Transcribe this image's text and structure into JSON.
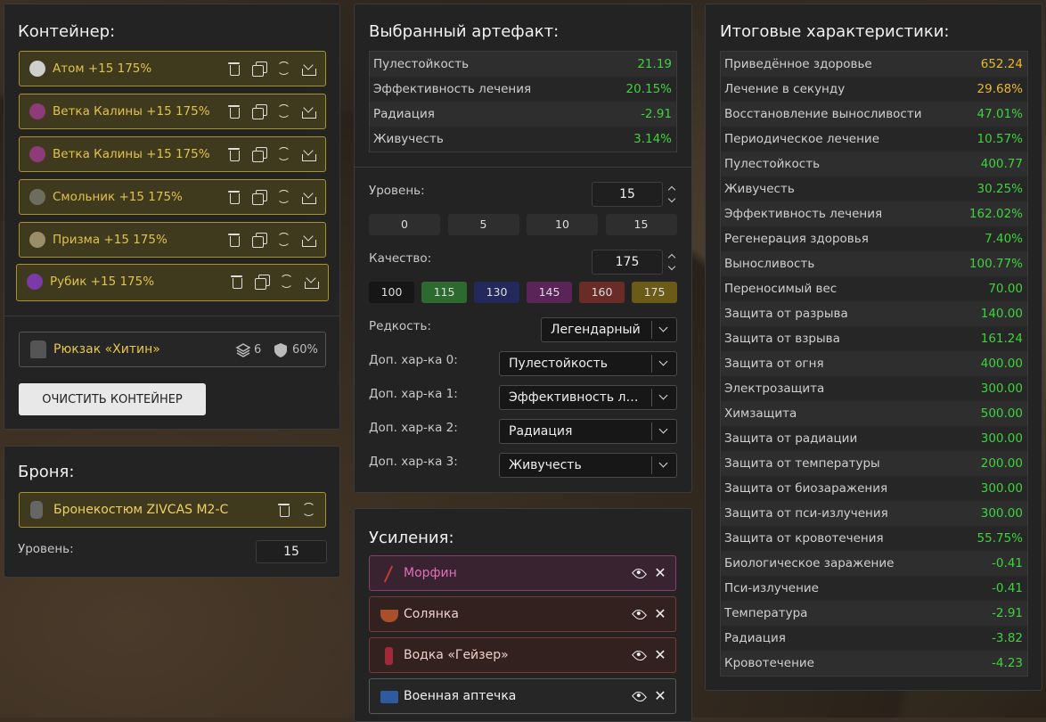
{
  "container": {
    "title": "Контейнер:",
    "artifacts": [
      {
        "name": "Атом +15 175%",
        "icon": "atom-icon",
        "color": "#cfcfcf"
      },
      {
        "name": "Ветка Калины +15 175%",
        "icon": "viburnum-icon",
        "color": "#8e3b7a"
      },
      {
        "name": "Ветка Калины +15 175%",
        "icon": "viburnum-icon",
        "color": "#8e3b7a"
      },
      {
        "name": "Смольник +15 175%",
        "icon": "resin-icon",
        "color": "#6d6d5f"
      },
      {
        "name": "Призма +15 175%",
        "icon": "prism-icon",
        "color": "#9a8e6a"
      },
      {
        "name": "Рубик +15 175%",
        "icon": "rubik-icon",
        "color": "#7a3aa8"
      }
    ],
    "backpack": {
      "name": "Рюкзак «Хитин»",
      "slots": "6",
      "protection": "60%"
    },
    "clear_button": "ОЧИСТИТЬ КОНТЕЙНЕР"
  },
  "armor": {
    "title": "Броня:",
    "name": "Бронекостюм ZIVCAS M2-C",
    "level_label": "Уровень:",
    "level": "15"
  },
  "selected": {
    "title": "Выбранный артефакт:",
    "stats": [
      {
        "name": "Пулестойкость",
        "value": "21.19"
      },
      {
        "name": "Эффективность лечения",
        "value": "20.15%"
      },
      {
        "name": "Радиация",
        "value": "-2.91"
      },
      {
        "name": "Живучесть",
        "value": "3.14%"
      }
    ],
    "level_label": "Уровень:",
    "level": "15",
    "level_presets": [
      "0",
      "5",
      "10",
      "15"
    ],
    "quality_label": "Качество:",
    "quality": "175",
    "quality_presets": [
      {
        "label": "100",
        "color": "#161616"
      },
      {
        "label": "115",
        "color": "#2d6a2f"
      },
      {
        "label": "130",
        "color": "#23295a"
      },
      {
        "label": "145",
        "color": "#5a2458"
      },
      {
        "label": "160",
        "color": "#6a2c26"
      },
      {
        "label": "175",
        "color": "#6c5b18"
      }
    ],
    "rarity_label": "Редкость:",
    "rarity": "Легендарный",
    "extras": [
      {
        "label": "Доп. хар-ка 0:",
        "value": "Пулестойкость"
      },
      {
        "label": "Доп. хар-ка 1:",
        "value": "Эффективность ле..."
      },
      {
        "label": "Доп. хар-ка 2:",
        "value": "Радиация"
      },
      {
        "label": "Доп. хар-ка 3:",
        "value": "Живучесть"
      }
    ]
  },
  "boosts": {
    "title": "Усиления:",
    "items": [
      {
        "name": "Морфин",
        "icon": "morphine-icon",
        "text": "#e070b8",
        "border": "#8a3e72",
        "bg": "#3a2330"
      },
      {
        "name": "Солянка",
        "icon": "soup-icon",
        "text": "#f0d0c8",
        "border": "#7a3a36",
        "bg": "#33211f"
      },
      {
        "name": "Водка «Гейзер»",
        "icon": "vodka-icon",
        "text": "#f0d0c8",
        "border": "#7a3a36",
        "bg": "#33211f"
      },
      {
        "name": "Военная аптечка",
        "icon": "medkit-icon",
        "text": "#f0f0f0",
        "border": "#5a5a5a",
        "bg": "#262626"
      }
    ]
  },
  "totals": {
    "title": "Итоговые характеристики:",
    "stats": [
      {
        "name": "Приведённое здоровье",
        "value": "652.24",
        "c": "y"
      },
      {
        "name": "Лечение в секунду",
        "value": "29.68%",
        "c": "y"
      },
      {
        "name": "Восстановление выносливости",
        "value": "47.01%",
        "c": "g"
      },
      {
        "name": "Периодическое лечение",
        "value": "10.57%",
        "c": "g"
      },
      {
        "name": "Пулестойкость",
        "value": "400.77",
        "c": "g"
      },
      {
        "name": "Живучесть",
        "value": "30.25%",
        "c": "g"
      },
      {
        "name": "Эффективность лечения",
        "value": "162.02%",
        "c": "g"
      },
      {
        "name": "Регенерация здоровья",
        "value": "7.40%",
        "c": "g"
      },
      {
        "name": "Выносливость",
        "value": "100.77%",
        "c": "g"
      },
      {
        "name": "Переносимый вес",
        "value": "70.00",
        "c": "g"
      },
      {
        "name": "Защита от разрыва",
        "value": "140.00",
        "c": "g"
      },
      {
        "name": "Защита от взрыва",
        "value": "161.24",
        "c": "g"
      },
      {
        "name": "Защита от огня",
        "value": "400.00",
        "c": "g"
      },
      {
        "name": "Электрозащита",
        "value": "300.00",
        "c": "g"
      },
      {
        "name": "Химзащита",
        "value": "500.00",
        "c": "g"
      },
      {
        "name": "Защита от радиации",
        "value": "300.00",
        "c": "g"
      },
      {
        "name": "Защита от температуры",
        "value": "200.00",
        "c": "g"
      },
      {
        "name": "Защита от биозаражения",
        "value": "300.00",
        "c": "g"
      },
      {
        "name": "Защита от пси-излучения",
        "value": "300.00",
        "c": "g"
      },
      {
        "name": "Защита от кровотечения",
        "value": "55.75%",
        "c": "g"
      },
      {
        "name": "Биологическое заражение",
        "value": "-0.41",
        "c": "g"
      },
      {
        "name": "Пси-излучение",
        "value": "-0.41",
        "c": "g"
      },
      {
        "name": "Температура",
        "value": "-2.91",
        "c": "g"
      },
      {
        "name": "Радиация",
        "value": "-3.82",
        "c": "g"
      },
      {
        "name": "Кровотечение",
        "value": "-4.23",
        "c": "g"
      }
    ]
  }
}
